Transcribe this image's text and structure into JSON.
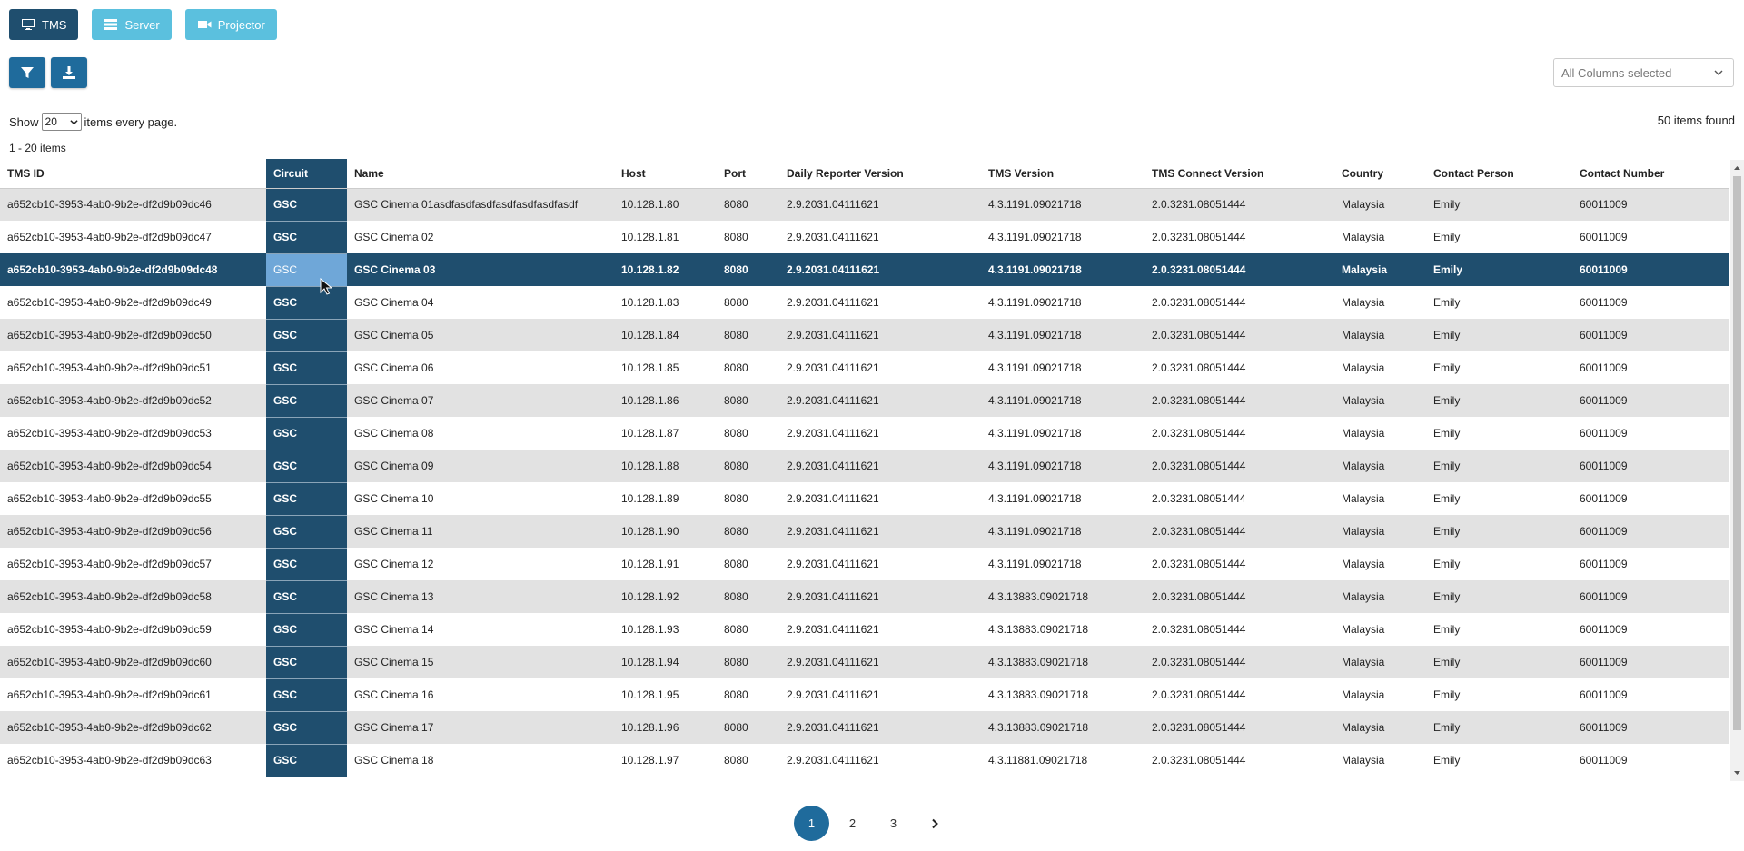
{
  "topnav": {
    "tms_label": "TMS",
    "server_label": "Server",
    "projector_label": "Projector"
  },
  "toolbar": {
    "filter_icon": "filter-icon",
    "download_icon": "download-icon"
  },
  "column_select": {
    "value": "All Columns selected"
  },
  "paging_controls": {
    "show_label": "Show",
    "page_size": "20",
    "items_suffix": "items every page.",
    "found_text": "50 items found",
    "range_text": "1 - 20 items"
  },
  "table": {
    "columns": [
      "TMS ID",
      "Circuit",
      "Name",
      "Host",
      "Port",
      "Daily Reporter Version",
      "TMS Version",
      "TMS Connect Version",
      "Country",
      "Contact Person",
      "Contact Number"
    ],
    "selected_row": 2,
    "rows": [
      [
        "a652cb10-3953-4ab0-9b2e-df2d9b09dc46",
        "GSC",
        "GSC Cinema 01asdfasdfasdfasdfasdfasdfasdf",
        "10.128.1.80",
        "8080",
        "2.9.2031.04111621",
        "4.3.1191.09021718",
        "2.0.3231.08051444",
        "Malaysia",
        "Emily",
        "60011009"
      ],
      [
        "a652cb10-3953-4ab0-9b2e-df2d9b09dc47",
        "GSC",
        "GSC Cinema 02",
        "10.128.1.81",
        "8080",
        "2.9.2031.04111621",
        "4.3.1191.09021718",
        "2.0.3231.08051444",
        "Malaysia",
        "Emily",
        "60011009"
      ],
      [
        "a652cb10-3953-4ab0-9b2e-df2d9b09dc48",
        "GSC",
        "GSC Cinema 03",
        "10.128.1.82",
        "8080",
        "2.9.2031.04111621",
        "4.3.1191.09021718",
        "2.0.3231.08051444",
        "Malaysia",
        "Emily",
        "60011009"
      ],
      [
        "a652cb10-3953-4ab0-9b2e-df2d9b09dc49",
        "GSC",
        "GSC Cinema 04",
        "10.128.1.83",
        "8080",
        "2.9.2031.04111621",
        "4.3.1191.09021718",
        "2.0.3231.08051444",
        "Malaysia",
        "Emily",
        "60011009"
      ],
      [
        "a652cb10-3953-4ab0-9b2e-df2d9b09dc50",
        "GSC",
        "GSC Cinema 05",
        "10.128.1.84",
        "8080",
        "2.9.2031.04111621",
        "4.3.1191.09021718",
        "2.0.3231.08051444",
        "Malaysia",
        "Emily",
        "60011009"
      ],
      [
        "a652cb10-3953-4ab0-9b2e-df2d9b09dc51",
        "GSC",
        "GSC Cinema 06",
        "10.128.1.85",
        "8080",
        "2.9.2031.04111621",
        "4.3.1191.09021718",
        "2.0.3231.08051444",
        "Malaysia",
        "Emily",
        "60011009"
      ],
      [
        "a652cb10-3953-4ab0-9b2e-df2d9b09dc52",
        "GSC",
        "GSC Cinema 07",
        "10.128.1.86",
        "8080",
        "2.9.2031.04111621",
        "4.3.1191.09021718",
        "2.0.3231.08051444",
        "Malaysia",
        "Emily",
        "60011009"
      ],
      [
        "a652cb10-3953-4ab0-9b2e-df2d9b09dc53",
        "GSC",
        "GSC Cinema 08",
        "10.128.1.87",
        "8080",
        "2.9.2031.04111621",
        "4.3.1191.09021718",
        "2.0.3231.08051444",
        "Malaysia",
        "Emily",
        "60011009"
      ],
      [
        "a652cb10-3953-4ab0-9b2e-df2d9b09dc54",
        "GSC",
        "GSC Cinema 09",
        "10.128.1.88",
        "8080",
        "2.9.2031.04111621",
        "4.3.1191.09021718",
        "2.0.3231.08051444",
        "Malaysia",
        "Emily",
        "60011009"
      ],
      [
        "a652cb10-3953-4ab0-9b2e-df2d9b09dc55",
        "GSC",
        "GSC Cinema 10",
        "10.128.1.89",
        "8080",
        "2.9.2031.04111621",
        "4.3.1191.09021718",
        "2.0.3231.08051444",
        "Malaysia",
        "Emily",
        "60011009"
      ],
      [
        "a652cb10-3953-4ab0-9b2e-df2d9b09dc56",
        "GSC",
        "GSC Cinema 11",
        "10.128.1.90",
        "8080",
        "2.9.2031.04111621",
        "4.3.1191.09021718",
        "2.0.3231.08051444",
        "Malaysia",
        "Emily",
        "60011009"
      ],
      [
        "a652cb10-3953-4ab0-9b2e-df2d9b09dc57",
        "GSC",
        "GSC Cinema 12",
        "10.128.1.91",
        "8080",
        "2.9.2031.04111621",
        "4.3.1191.09021718",
        "2.0.3231.08051444",
        "Malaysia",
        "Emily",
        "60011009"
      ],
      [
        "a652cb10-3953-4ab0-9b2e-df2d9b09dc58",
        "GSC",
        "GSC Cinema 13",
        "10.128.1.92",
        "8080",
        "2.9.2031.04111621",
        "4.3.13883.09021718",
        "2.0.3231.08051444",
        "Malaysia",
        "Emily",
        "60011009"
      ],
      [
        "a652cb10-3953-4ab0-9b2e-df2d9b09dc59",
        "GSC",
        "GSC Cinema 14",
        "10.128.1.93",
        "8080",
        "2.9.2031.04111621",
        "4.3.13883.09021718",
        "2.0.3231.08051444",
        "Malaysia",
        "Emily",
        "60011009"
      ],
      [
        "a652cb10-3953-4ab0-9b2e-df2d9b09dc60",
        "GSC",
        "GSC Cinema 15",
        "10.128.1.94",
        "8080",
        "2.9.2031.04111621",
        "4.3.13883.09021718",
        "2.0.3231.08051444",
        "Malaysia",
        "Emily",
        "60011009"
      ],
      [
        "a652cb10-3953-4ab0-9b2e-df2d9b09dc61",
        "GSC",
        "GSC Cinema 16",
        "10.128.1.95",
        "8080",
        "2.9.2031.04111621",
        "4.3.13883.09021718",
        "2.0.3231.08051444",
        "Malaysia",
        "Emily",
        "60011009"
      ],
      [
        "a652cb10-3953-4ab0-9b2e-df2d9b09dc62",
        "GSC",
        "GSC Cinema 17",
        "10.128.1.96",
        "8080",
        "2.9.2031.04111621",
        "4.3.13883.09021718",
        "2.0.3231.08051444",
        "Malaysia",
        "Emily",
        "60011009"
      ],
      [
        "a652cb10-3953-4ab0-9b2e-df2d9b09dc63",
        "GSC",
        "GSC Cinema 18",
        "10.128.1.97",
        "8080",
        "2.9.2031.04111621",
        "4.3.11881.09021718",
        "2.0.3231.08051444",
        "Malaysia",
        "Emily",
        "60011009"
      ]
    ]
  },
  "pagination": {
    "pages": [
      "1",
      "2",
      "3"
    ],
    "current": "1",
    "next_icon": "chevron-right-icon"
  },
  "colors": {
    "primary_dark": "#1f4e6e",
    "primary": "#1f6b9c",
    "light_button": "#5bc0de",
    "row_alt": "#e2e2e2",
    "selected_cell": "#6fa7d8"
  }
}
